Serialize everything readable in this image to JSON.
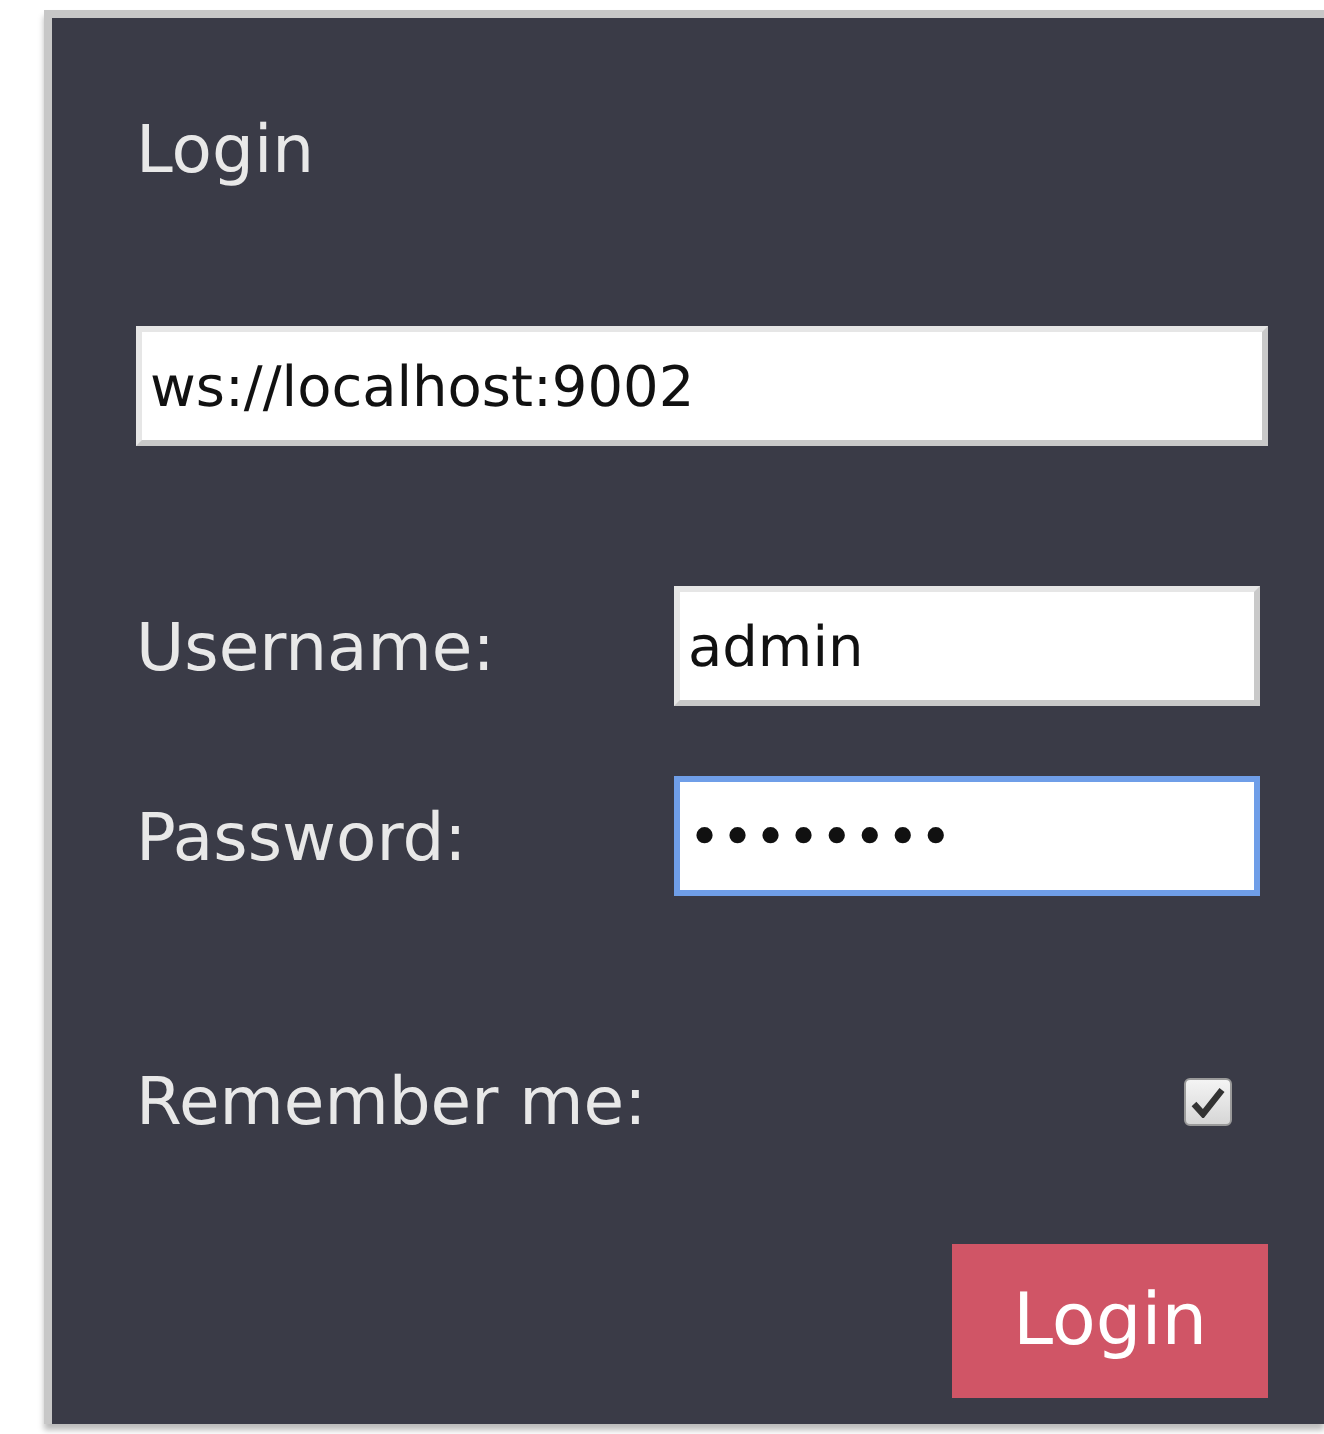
{
  "title": "Login",
  "server": {
    "value": "ws://localhost:9002"
  },
  "fields": [
    {
      "label": "Username:",
      "value": "admin",
      "focused": false
    },
    {
      "label": "Password:",
      "value": "••••••••",
      "focused": true
    }
  ],
  "remember": {
    "label": "Remember me:",
    "checked": true
  },
  "button": {
    "label": "Login"
  }
}
